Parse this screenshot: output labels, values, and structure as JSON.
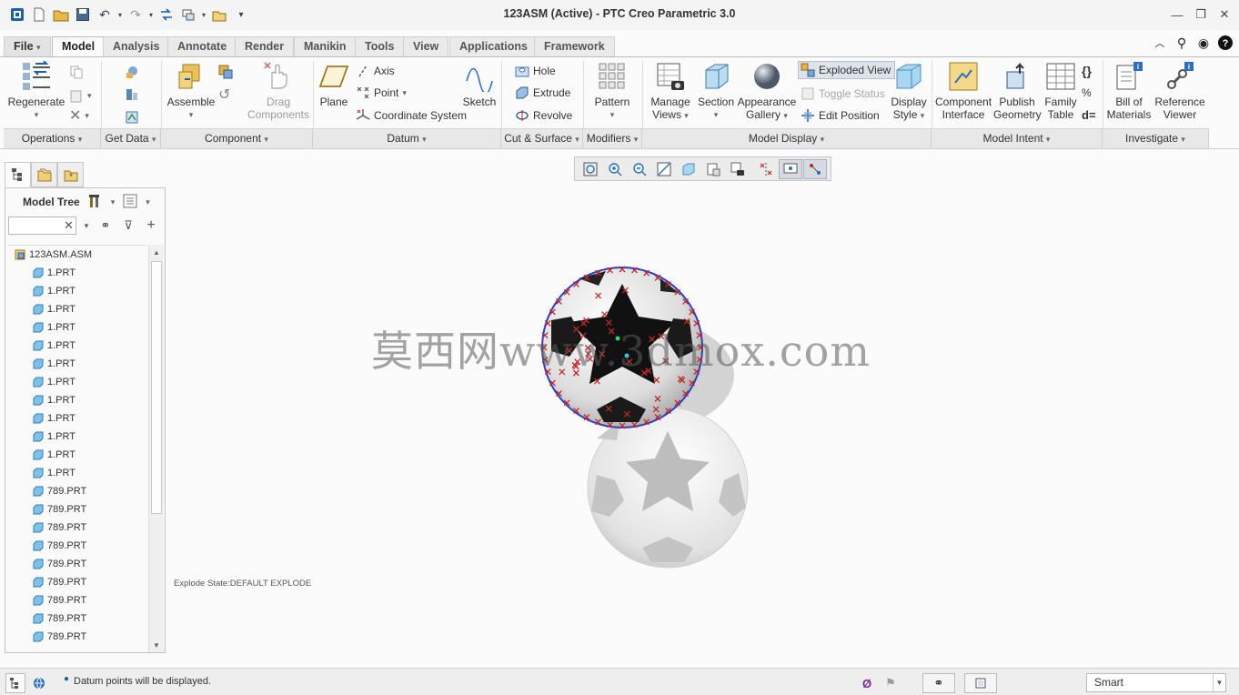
{
  "window": {
    "title": "123ASM (Active) - PTC Creo Parametric 3.0"
  },
  "tabs": [
    {
      "label": "File",
      "dropdown": true
    },
    {
      "label": "Model",
      "active": true
    },
    {
      "label": "Analysis"
    },
    {
      "label": "Annotate"
    },
    {
      "label": "Render"
    },
    {
      "label": "Manikin"
    },
    {
      "label": "Tools"
    },
    {
      "label": "View"
    },
    {
      "label": "Applications"
    },
    {
      "label": "Framework"
    }
  ],
  "ribbon": {
    "regenerate": "Regenerate",
    "assemble": "Assemble",
    "drag_components": [
      "Drag",
      "Components"
    ],
    "plane": "Plane",
    "axis": "Axis",
    "point": "Point",
    "coordinate_system": "Coordinate System",
    "sketch": "Sketch",
    "hole": "Hole",
    "extrude": "Extrude",
    "revolve": "Revolve",
    "pattern": "Pattern",
    "manage_views": [
      "Manage",
      "Views"
    ],
    "section": "Section",
    "appearance_gallery": [
      "Appearance",
      "Gallery"
    ],
    "exploded_view": "Exploded View",
    "toggle_status": "Toggle Status",
    "edit_position": "Edit Position",
    "display_style": [
      "Display",
      "Style"
    ],
    "component_interface": [
      "Component",
      "Interface"
    ],
    "publish_geometry": [
      "Publish",
      "Geometry"
    ],
    "family_table": [
      "Family",
      "Table"
    ],
    "bill_of_materials": [
      "Bill of",
      "Materials"
    ],
    "reference_viewer": [
      "Reference",
      "Viewer"
    ]
  },
  "groups": [
    "Operations",
    "Get Data",
    "Component",
    "Datum",
    "Cut & Surface",
    "Modifiers",
    "Model Display",
    "Model Intent",
    "Investigate"
  ],
  "model_tree": {
    "title": "Model Tree",
    "search_value": "",
    "items": [
      {
        "label": "123ASM.ASM",
        "level": 0
      },
      {
        "label": "1.PRT",
        "level": 1
      },
      {
        "label": "1.PRT",
        "level": 1
      },
      {
        "label": "1.PRT",
        "level": 1
      },
      {
        "label": "1.PRT",
        "level": 1
      },
      {
        "label": "1.PRT",
        "level": 1
      },
      {
        "label": "1.PRT",
        "level": 1
      },
      {
        "label": "1.PRT",
        "level": 1
      },
      {
        "label": "1.PRT",
        "level": 1
      },
      {
        "label": "1.PRT",
        "level": 1
      },
      {
        "label": "1.PRT",
        "level": 1
      },
      {
        "label": "1.PRT",
        "level": 1
      },
      {
        "label": "1.PRT",
        "level": 1
      },
      {
        "label": "789.PRT",
        "level": 1
      },
      {
        "label": "789.PRT",
        "level": 1
      },
      {
        "label": "789.PRT",
        "level": 1
      },
      {
        "label": "789.PRT",
        "level": 1
      },
      {
        "label": "789.PRT",
        "level": 1
      },
      {
        "label": "789.PRT",
        "level": 1
      },
      {
        "label": "789.PRT",
        "level": 1
      },
      {
        "label": "789.PRT",
        "level": 1
      },
      {
        "label": "789.PRT",
        "level": 1
      }
    ]
  },
  "viewport": {
    "explode_state": "Explode State:DEFAULT EXPLODE",
    "watermark": "莫西网www.3dmox.com"
  },
  "status": {
    "message": "Datum points will be displayed.",
    "selection_filter": "Smart"
  },
  "colors": {
    "accent": "#3b78c4",
    "datum_point": "#c0282a",
    "ribbon_bg": "#fbfbfb"
  }
}
